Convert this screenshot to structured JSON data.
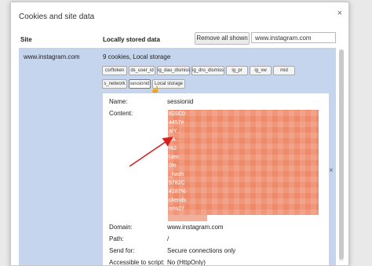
{
  "dialog": {
    "title": "Cookies and site data",
    "close_glyph": "×"
  },
  "header": {
    "site_col": "Site",
    "local_col": "Locally stored data",
    "remove_all": "Remove all shown",
    "search_value": "www.instagram.com"
  },
  "site": {
    "name": "www.instagram.com",
    "summary": "9 cookies, Local storage",
    "chips": [
      "csrftoken",
      "ds_user_id",
      "ig_dau_dismiss",
      "ig_dru_dismiss",
      "ig_pr",
      "ig_vw",
      "mid",
      "s_network",
      "sessionid",
      "Local storage"
    ],
    "active_chip": "sessionid",
    "remove_glyph": "×"
  },
  "details": {
    "name_label": "Name:",
    "name_value": "sessionid",
    "content_label": "Content:",
    "content_fragments": [
      "IGSC0",
      "4457e",
      "aIY...",
      "1A...",
      "%2",
      "Uen",
      "0fe",
      "_hash",
      "5782C",
      "4187%",
      "ckends",
      "m%27"
    ],
    "domain_label": "Domain:",
    "domain_value": "www.instagram.com",
    "path_label": "Path:",
    "path_value": "/",
    "send_label": "Send for:",
    "send_value": "Secure connections only",
    "script_label": "Accessible to script:",
    "script_value": "No (HttpOnly)"
  },
  "colors": {
    "selection_bg": "#c5d5ee",
    "redaction": "#ee8a6a",
    "annotation_arrow": "#d62020"
  }
}
